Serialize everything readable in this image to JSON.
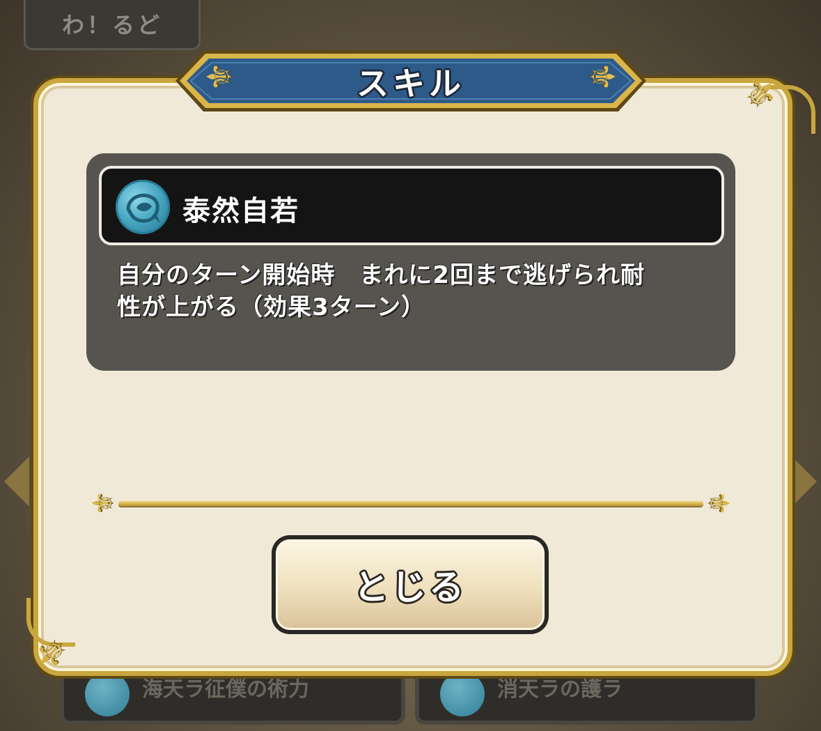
{
  "background": {
    "top_tab_label": "わ！るど",
    "bottom_card_left_label": "海天ラ征僕の術力",
    "bottom_card_right_label": "消天ラの護ラ"
  },
  "dialog": {
    "title": "スキル",
    "skill": {
      "icon": "fish-skill-icon",
      "name": "泰然自若",
      "description_line1": "自分のターン開始時　まれに2回まで逃げられ耐",
      "description_line2": "性が上がる（効果3ターン）"
    },
    "close_button_label": "とじる"
  },
  "colors": {
    "banner_blue": "#2e5a8a",
    "gold": "#c9a63e",
    "panel_bg": "#f1e9d8",
    "skill_panel": "#57544f"
  }
}
